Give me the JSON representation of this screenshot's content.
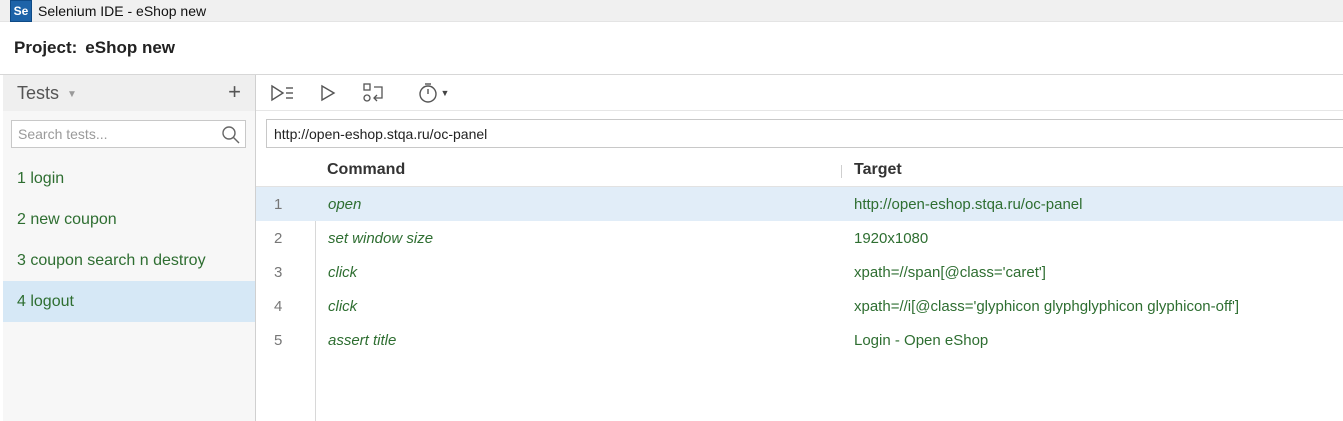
{
  "window": {
    "title": "Selenium IDE - eShop new",
    "logo_text": "Se"
  },
  "project": {
    "label": "Project:",
    "name": "eShop new"
  },
  "sidebar": {
    "header_label": "Tests",
    "add_label": "+",
    "search_placeholder": "Search tests...",
    "tests": [
      {
        "label": "1 login",
        "selected": false
      },
      {
        "label": "2 new coupon",
        "selected": false
      },
      {
        "label": "3 coupon search n destroy",
        "selected": false
      },
      {
        "label": "4 logout",
        "selected": true
      }
    ]
  },
  "toolbar": {
    "icons": [
      "run-all-icon",
      "run-icon",
      "step-icon",
      "speed-icon"
    ]
  },
  "url": {
    "value": "http://open-eshop.stqa.ru/oc-panel"
  },
  "table": {
    "headers": {
      "command": "Command",
      "target": "Target"
    },
    "rows": [
      {
        "num": "1",
        "command": "open",
        "target": "http://open-eshop.stqa.ru/oc-panel",
        "selected": true
      },
      {
        "num": "2",
        "command": "set window size",
        "target": "1920x1080",
        "selected": false
      },
      {
        "num": "3",
        "command": "click",
        "target": "xpath=//span[@class='caret']",
        "selected": false
      },
      {
        "num": "4",
        "command": "click",
        "target": "xpath=//i[@class='glyphicon glyphglyphicon glyphicon-off']",
        "selected": false
      },
      {
        "num": "5",
        "command": "assert title",
        "target": "Login - Open eShop",
        "selected": false
      }
    ]
  },
  "colors": {
    "accent_green": "#2e6e31",
    "selection_blue": "#d6e8f6"
  }
}
